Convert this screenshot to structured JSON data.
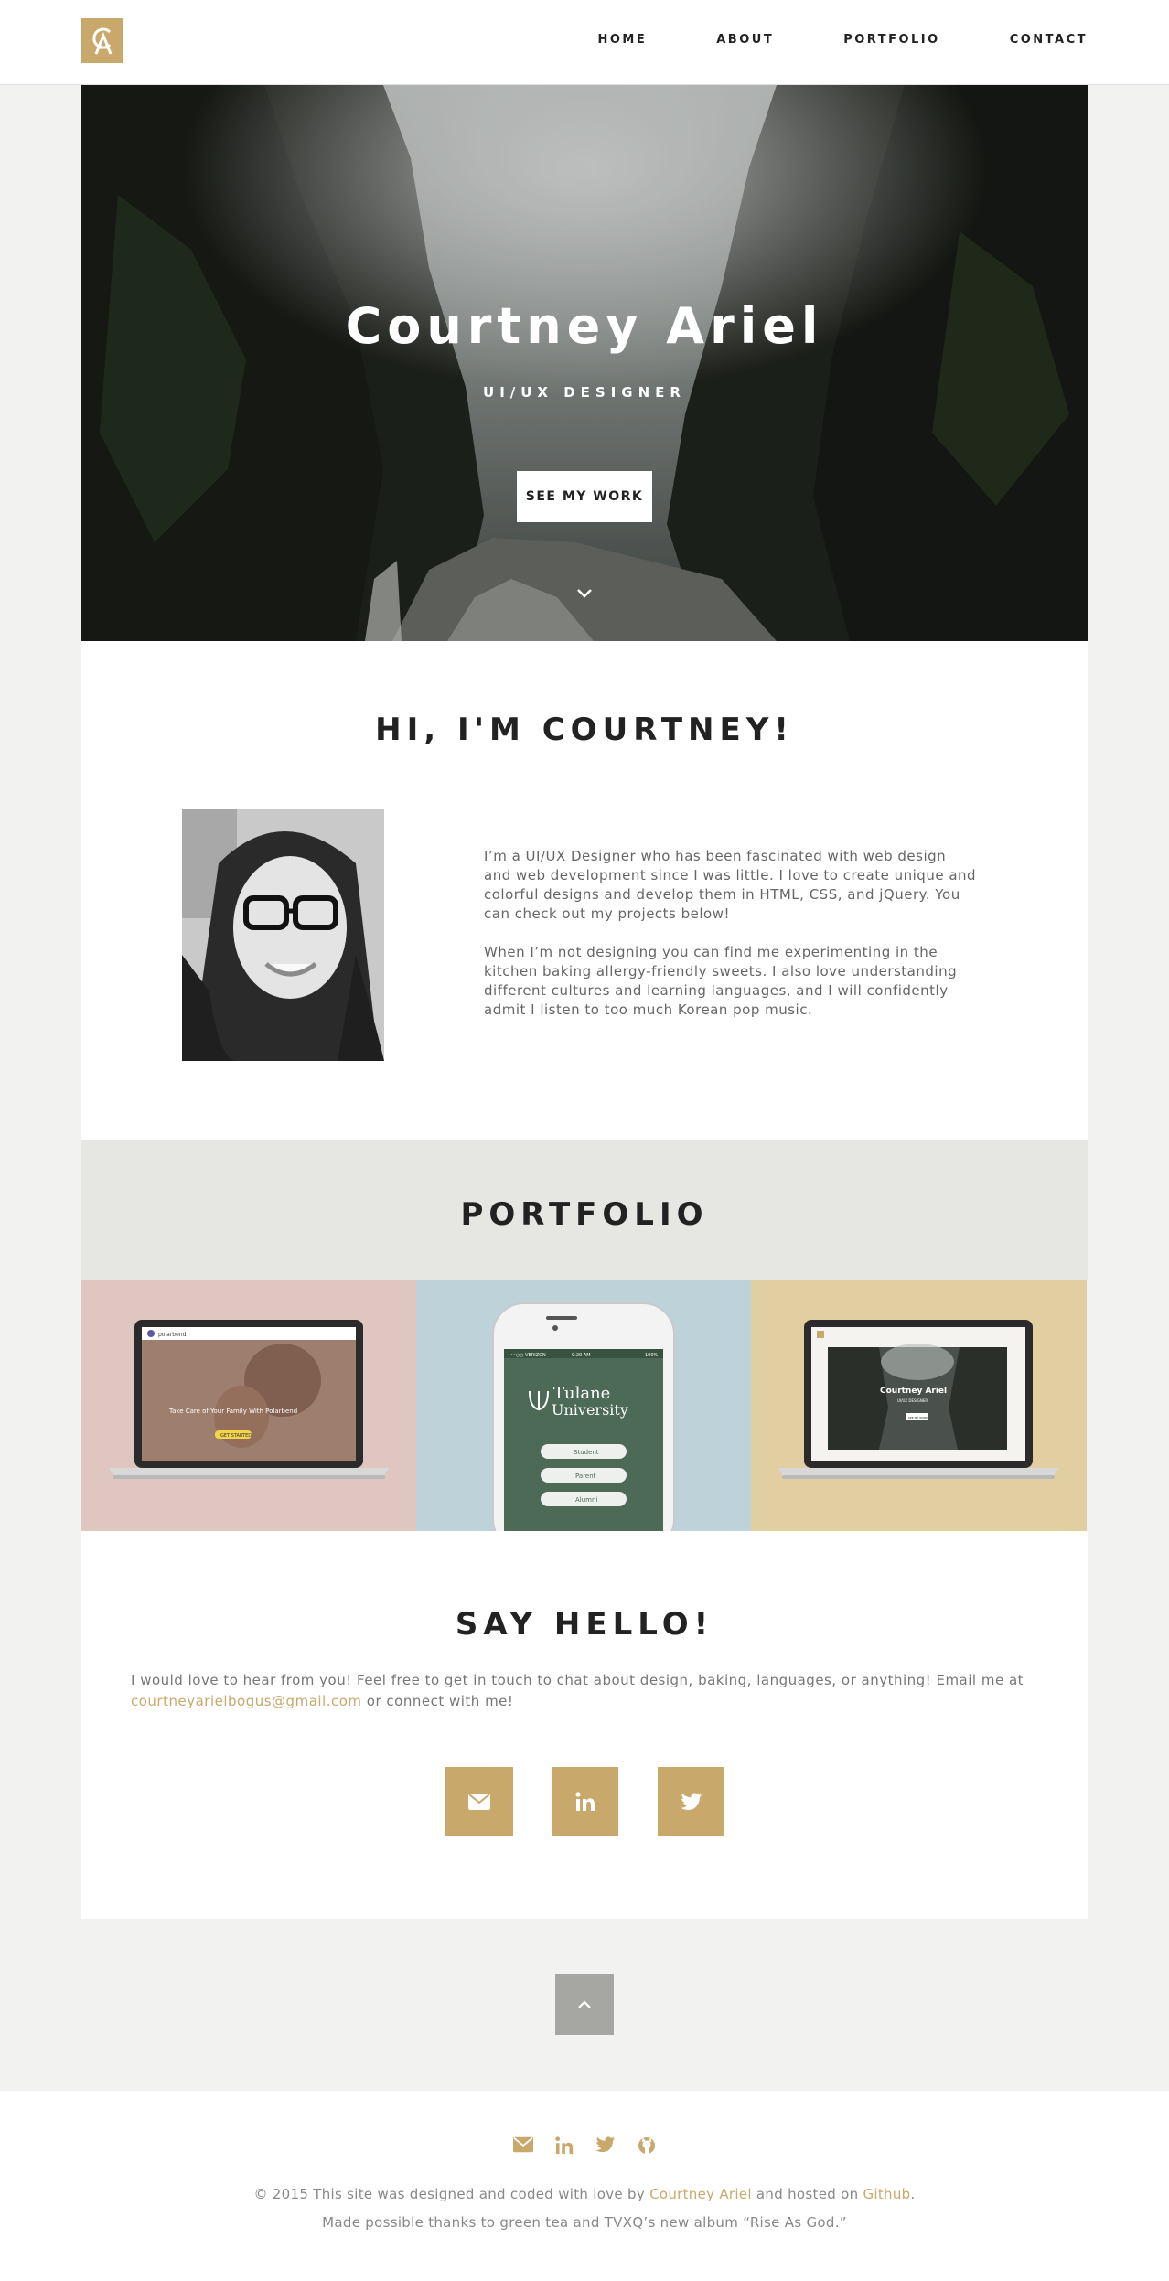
{
  "nav": {
    "logo_label": "CA logo",
    "items": [
      {
        "label": "HOME"
      },
      {
        "label": "ABOUT"
      },
      {
        "label": "PORTFOLIO"
      },
      {
        "label": "CONTACT"
      }
    ]
  },
  "hero": {
    "title": "Courtney Ariel",
    "subtitle": "UI/UX DESIGNER",
    "button": "SEE MY WORK"
  },
  "about": {
    "heading": "HI, I'M COURTNEY!",
    "paragraph1": "I’m a UI/UX Designer who has been fascinated with web design and web development since I was little. I love to create unique and colorful designs and develop them in HTML, CSS, and jQuery. You can check out my projects below!",
    "paragraph2": "When I’m not designing you can find me experimenting in the kitchen baking allergy-friendly sweets. I also love understanding different cultures and learning languages, and I will confidently admit I listen to too much Korean pop music."
  },
  "portfolio": {
    "heading": "PORTFOLIO",
    "tile1": {
      "brand": "polarbend",
      "headline": "Take Care of Your Family With Polarbend",
      "cta": "GET STARTED"
    },
    "tile2": {
      "carrier": "•••○○ VERIZON",
      "time": "9:20 AM",
      "battery": "100%",
      "logo_line1": "Tulane",
      "logo_line2": "University",
      "buttons": [
        "Student",
        "Parent",
        "Alumni"
      ]
    },
    "tile3": {
      "site_title": "Courtney Ariel",
      "site_sub": "UI/UX DESIGNER",
      "site_btn": "SEE MY WORK"
    }
  },
  "contact": {
    "heading": "SAY HELLO!",
    "text_before": "I would love to hear from you! Feel free to get in touch to chat about design, baking, languages, or anything! Email me at ",
    "email": "courtneyarielbogus@gmail.com",
    "text_after": " or connect with me!"
  },
  "footer": {
    "line1_before": "© 2015 This site was designed and coded with love by ",
    "line1_name": "Courtney Ariel",
    "line1_mid": " and hosted on ",
    "line1_host": "Github",
    "line1_end": ".",
    "line2": "Made possible thanks to green tea and TVXQ’s new album “Rise As God.”"
  },
  "colors": {
    "accent": "#c9a86c",
    "background": "#f2f2f0",
    "portfolio_band": "#e6e6e3"
  }
}
